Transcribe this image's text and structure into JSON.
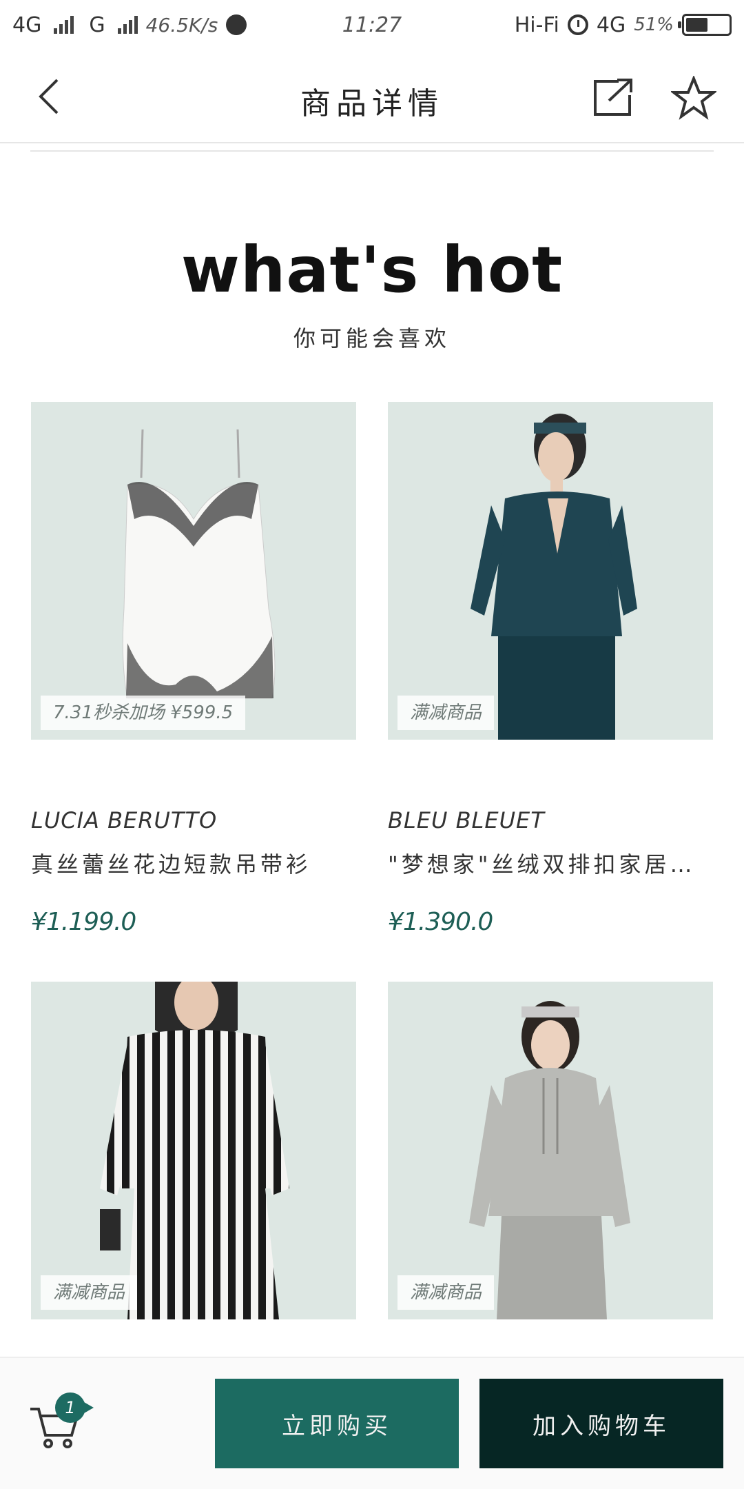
{
  "status_bar": {
    "network1": "4G",
    "network2": "G",
    "speed": "46.5K/s",
    "time": "11:27",
    "hifi": "Hi-Fi",
    "network3": "4G",
    "battery_pct": "51%",
    "battery_level": 0.51
  },
  "header": {
    "title": "商品详情"
  },
  "section": {
    "title": "what's hot",
    "subtitle": "你可能会喜欢"
  },
  "products": [
    {
      "badge": "7.31秒杀加场 ¥599.5",
      "brand": "LUCIA BERUTTO",
      "name": "真丝蕾丝花边短款吊带衫",
      "price": "¥1.199.0",
      "image": "white-lace-camisole"
    },
    {
      "badge": "满减商品",
      "brand": "BLEU BLEUET",
      "name": "\"梦想家\"丝绒双排扣家居…",
      "price": "¥1.390.0",
      "image": "velvet-pajama-set"
    },
    {
      "badge": "满减商品",
      "brand": "",
      "name": "",
      "price": "",
      "image": "striped-pajama-set"
    },
    {
      "badge": "满减商品",
      "brand": "",
      "name": "",
      "price": "",
      "image": "grey-knit-hoodie-set"
    }
  ],
  "bottom_bar": {
    "cart_count": "1",
    "buy_now": "立即购买",
    "add_to_cart": "加入购物车"
  },
  "colors": {
    "primary_green": "#1c6b61",
    "dark_green": "#062624",
    "price_green": "#1d5e55",
    "image_bg": "#dde6e2"
  }
}
